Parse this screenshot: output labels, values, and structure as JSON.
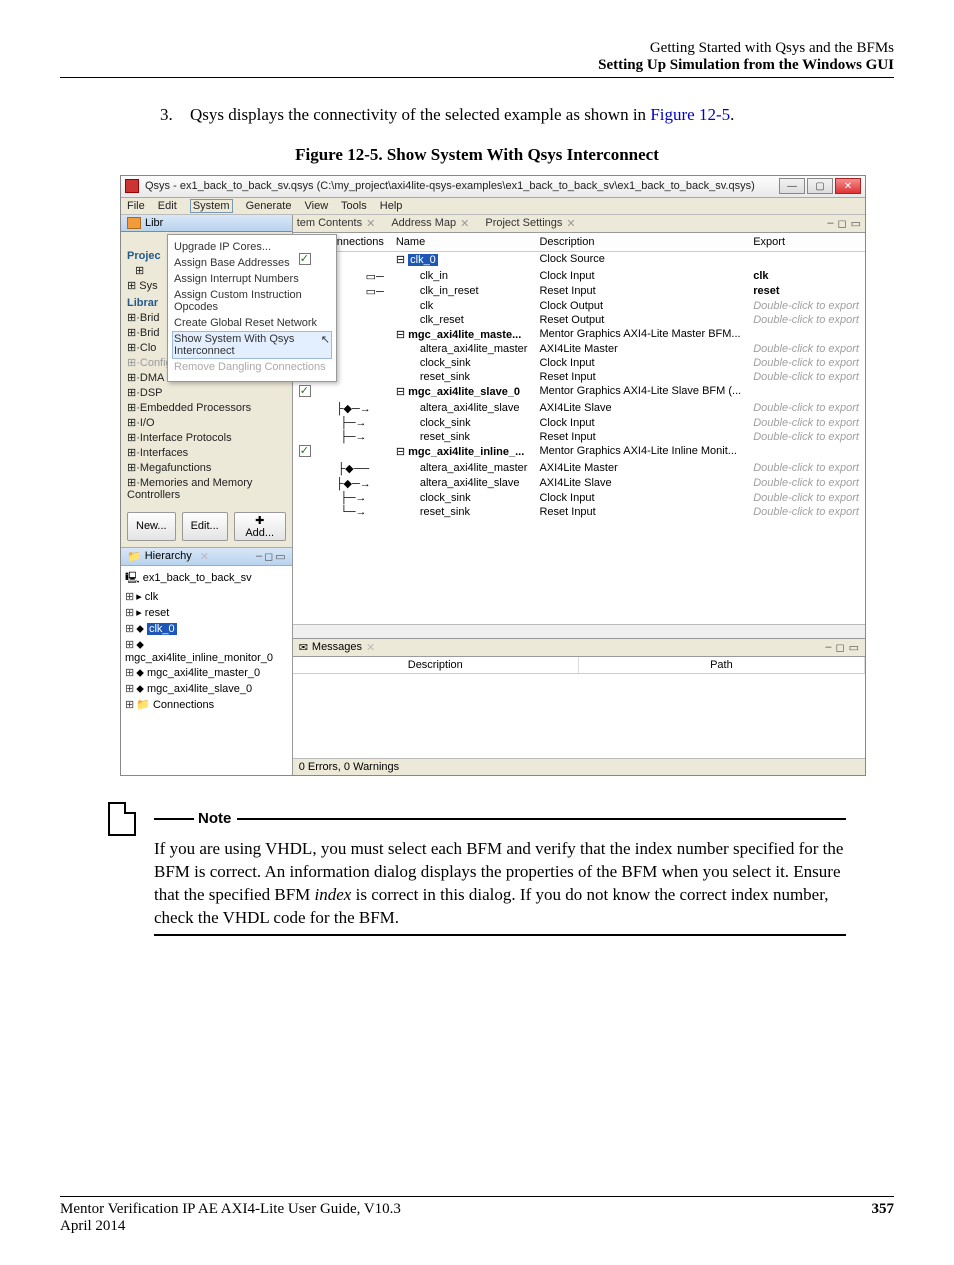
{
  "header": {
    "line1": "Getting Started with Qsys and the BFMs",
    "line2": "Setting Up Simulation from the Windows GUI"
  },
  "listItem": {
    "num": "3.",
    "text_a": "Qsys displays the connectivity of the selected example as shown in ",
    "link": "Figure 12-5",
    "text_b": "."
  },
  "figureCaption": "Figure 12-5. Show System With Qsys Interconnect",
  "qsys": {
    "title": "Qsys - ex1_back_to_back_sv.qsys (C:\\my_project\\axi4lite-qsys-examples\\ex1_back_to_back_sv\\ex1_back_to_back_sv.qsys)",
    "menubar": {
      "file": "File",
      "edit": "Edit",
      "system": "System",
      "generate": "Generate",
      "view": "View",
      "tools": "Tools",
      "help": "Help"
    },
    "libTab": "Libr",
    "dropdown": {
      "upgrade": "Upgrade IP Cores...",
      "assignBase": "Assign Base Addresses",
      "assignInt": "Assign Interrupt Numbers",
      "assignCustom": "Assign Custom Instruction Opcodes",
      "createReset": "Create Global Reset Network",
      "showSystem": "Show System With Qsys Interconnect",
      "removeDangling": "Remove Dangling Connections"
    },
    "libList": {
      "project": "Projec",
      "sys": "⊞ Sys",
      "library": "Librar",
      "brid1": "⊞·Brid",
      "brid2": "⊞·Brid",
      "cloc": "⊞·Clo",
      "config": "⊞·Configuration & Programming",
      "dma": "⊞·DMA",
      "dsp": "⊞·DSP",
      "embedded": "⊞·Embedded Processors",
      "io": "⊞·I/O",
      "ifproto": "⊞·Interface Protocols",
      "interfaces": "⊞·Interfaces",
      "mega": "⊞·Megafunctions",
      "mem": "⊞·Memories and Memory Controllers"
    },
    "libBtns": {
      "new": "New...",
      "edit": "Edit...",
      "add": "✚ Add..."
    },
    "hierTab": "Hierarchy",
    "hier": {
      "root": "ex1_back_to_back_sv",
      "clk": "clk",
      "reset": "reset",
      "clk0": "clk_0",
      "inline": "mgc_axi4lite_inline_monitor_0",
      "master": "mgc_axi4lite_master_0",
      "slave": "mgc_axi4lite_slave_0",
      "conn": "Connections"
    },
    "rightTabs": {
      "contents": "tem Contents",
      "addrmap": "Address Map",
      "projset": "Project Settings"
    },
    "cols": {
      "e": "e",
      "connections": "Connections",
      "name": "Name",
      "description": "Description",
      "export": "Export"
    },
    "rows": {
      "clk0": {
        "name": "clk_0",
        "desc": "Clock Source"
      },
      "clkin": {
        "name": "clk_in",
        "desc": "Clock Input",
        "exp": "clk"
      },
      "clkinreset": {
        "name": "clk_in_reset",
        "desc": "Reset Input",
        "exp": "reset"
      },
      "clk": {
        "name": "clk",
        "desc": "Clock Output",
        "exp": "Double-click to export"
      },
      "clkreset": {
        "name": "clk_reset",
        "desc": "Reset Output",
        "exp": "Double-click to export"
      },
      "master0": {
        "name": "mgc_axi4lite_maste...",
        "desc": "Mentor Graphics AXI4-Lite Master BFM..."
      },
      "masterif": {
        "name": "altera_axi4lite_master",
        "desc": "AXI4Lite Master",
        "exp": "Double-click to export"
      },
      "masterclk": {
        "name": "clock_sink",
        "desc": "Clock Input",
        "exp": "Double-click to export"
      },
      "masterrst": {
        "name": "reset_sink",
        "desc": "Reset Input",
        "exp": "Double-click to export"
      },
      "slave0": {
        "name": "mgc_axi4lite_slave_0",
        "desc": "Mentor Graphics AXI4-Lite Slave BFM (..."
      },
      "slaveif": {
        "name": "altera_axi4lite_slave",
        "desc": "AXI4Lite Slave",
        "exp": "Double-click to export"
      },
      "slaveclk": {
        "name": "clock_sink",
        "desc": "Clock Input",
        "exp": "Double-click to export"
      },
      "slaverst": {
        "name": "reset_sink",
        "desc": "Reset Input",
        "exp": "Double-click to export"
      },
      "inline0": {
        "name": "mgc_axi4lite_inline_...",
        "desc": "Mentor Graphics AXI4-Lite Inline Monit..."
      },
      "inlinem": {
        "name": "altera_axi4lite_master",
        "desc": "AXI4Lite Master",
        "exp": "Double-click to export"
      },
      "inlines": {
        "name": "altera_axi4lite_slave",
        "desc": "AXI4Lite Slave",
        "exp": "Double-click to export"
      },
      "inlineclk": {
        "name": "clock_sink",
        "desc": "Clock Input",
        "exp": "Double-click to export"
      },
      "inlinerst": {
        "name": "reset_sink",
        "desc": "Reset Input",
        "exp": "Double-click to export"
      }
    },
    "msgTab": "Messages",
    "msgCols": {
      "desc": "Description",
      "path": "Path"
    },
    "status": "0 Errors, 0 Warnings"
  },
  "note": {
    "label": "Note",
    "text_a": "If you are using VHDL, you must select each BFM and verify that the index number specified for the BFM is correct. An information dialog displays the properties of the BFM when you select it. Ensure that the specified BFM ",
    "em": "index",
    "text_b": " is correct in this dialog. If you do not know the correct index number, check the VHDL code for the BFM."
  },
  "footer": {
    "title": "Mentor Verification IP AE AXI4-Lite User Guide, V10.3",
    "page": "357",
    "date": "April 2014"
  }
}
